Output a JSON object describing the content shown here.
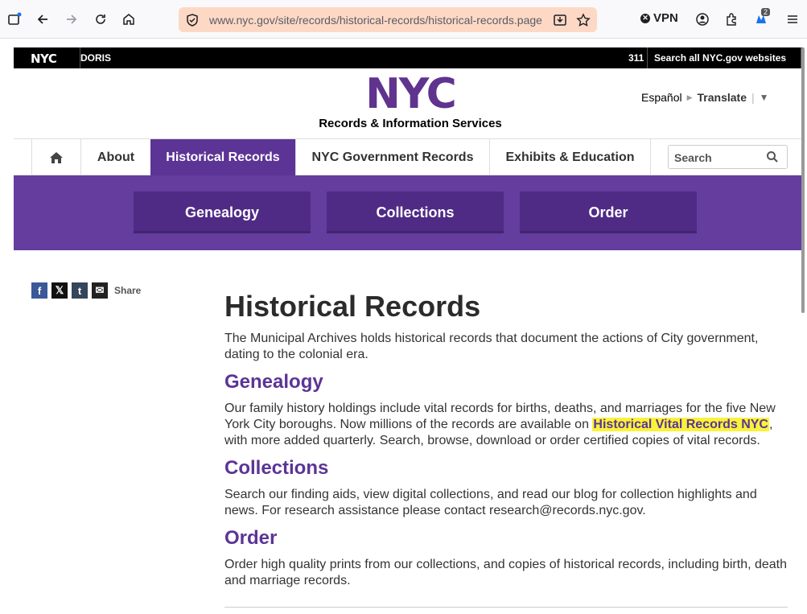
{
  "browser": {
    "url": "www.nyc.gov/site/records/historical-records/historical-records.page",
    "vpn_label": "VPN",
    "ext_badge": "2"
  },
  "topbar": {
    "nyc_label": "NYC",
    "agency": "DORIS",
    "phone": "311",
    "search_all": "Search all NYC.gov websites"
  },
  "header": {
    "logo_text": "NYC",
    "logo_sub": "Records & Information Services",
    "lang_espanol": "Español",
    "lang_translate": "Translate"
  },
  "nav": {
    "items": [
      {
        "label": "About"
      },
      {
        "label": "Historical Records"
      },
      {
        "label": "NYC Government Records"
      },
      {
        "label": "Exhibits & Education"
      }
    ],
    "search_placeholder": "Search"
  },
  "subnav": {
    "items": [
      {
        "label": "Genealogy"
      },
      {
        "label": "Collections"
      },
      {
        "label": "Order"
      }
    ]
  },
  "share": {
    "label": "Share"
  },
  "main": {
    "title": "Historical Records",
    "intro": "The Municipal Archives holds historical records that document the actions of City government, dating to the colonial era.",
    "sections": [
      {
        "heading": "Genealogy",
        "text_before": "Our family history holdings include vital records for births, deaths, and marriages for the five New York City boroughs. Now millions of the records are available on ",
        "link": "Historical Vital Records NYC",
        "text_after": ", with more added quarterly. Search, browse, download or order certified copies of vital records."
      },
      {
        "heading": "Collections",
        "text": "Search our finding aids, view digital collections, and read our blog for collection highlights and news. For research assistance please contact research@records.nyc.gov."
      },
      {
        "heading": "Order",
        "text": "Order high quality prints from our collections, and copies of historical records, including birth, death and marriage records."
      }
    ]
  },
  "colors": {
    "brand_purple": "#5c3496",
    "subnav_bg": "#643d9e",
    "highlight": "#f9f33a"
  }
}
